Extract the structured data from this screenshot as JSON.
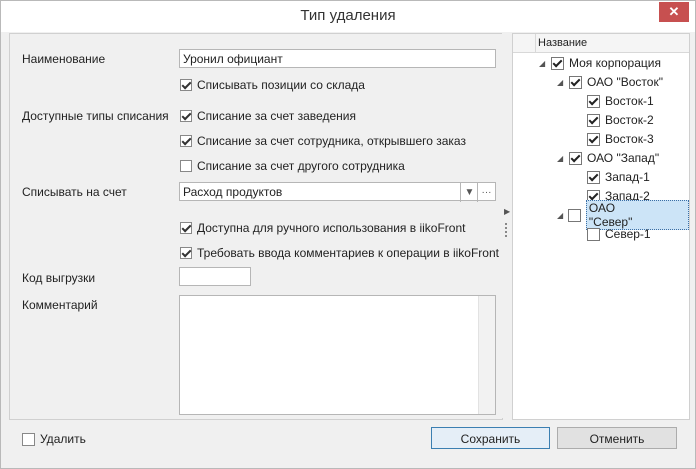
{
  "window": {
    "title": "Тип удаления",
    "close_glyph": "✕"
  },
  "form": {
    "name_label": "Наименование",
    "name_value": "Уронил официант",
    "write_off_stock": {
      "label": "Списывать позиции со склада",
      "checked": true
    },
    "types_label": "Доступные типы списания",
    "types": [
      {
        "label": "Списание за счет заведения",
        "checked": true
      },
      {
        "label": "Списание за счет сотрудника, открывшего заказ",
        "checked": true
      },
      {
        "label": "Списание за счет другого сотрудника",
        "checked": false
      }
    ],
    "account_label": "Списывать на счет",
    "account_value": "Расход продуктов",
    "account_more": "···",
    "manual_use": {
      "label": "Доступна для ручного использования в iikoFront",
      "checked": true
    },
    "require_comment": {
      "label": "Требовать ввода комментариев к операции в iikoFront",
      "checked": true
    },
    "export_code_label": "Код выгрузки",
    "export_code_value": "",
    "comment_label": "Комментарий",
    "comment_value": ""
  },
  "tree": {
    "header": "Название",
    "nodes": [
      {
        "label": "Моя корпорация",
        "checked": true,
        "level": 0,
        "expanded": true
      },
      {
        "label": "ОАО \"Восток\"",
        "checked": true,
        "level": 1,
        "expanded": true
      },
      {
        "label": "Восток-1",
        "checked": true,
        "level": 2
      },
      {
        "label": "Восток-2",
        "checked": true,
        "level": 2
      },
      {
        "label": "Восток-3",
        "checked": true,
        "level": 2
      },
      {
        "label": "ОАО \"Запад\"",
        "checked": true,
        "level": 1,
        "expanded": true
      },
      {
        "label": "Запад-1",
        "checked": true,
        "level": 2
      },
      {
        "label": "Запад-2",
        "checked": true,
        "level": 2
      },
      {
        "label": "ОАО \"Север\"",
        "checked": false,
        "level": 1,
        "expanded": true,
        "selected": true
      },
      {
        "label": "Север-1",
        "checked": false,
        "level": 2
      }
    ]
  },
  "footer": {
    "delete": {
      "label": "Удалить",
      "checked": false
    },
    "save_label": "Сохранить",
    "cancel_label": "Отменить"
  },
  "colors": {
    "selection": "#cce4f7",
    "close": "#c75050",
    "primary_border": "#3c7fb1"
  }
}
